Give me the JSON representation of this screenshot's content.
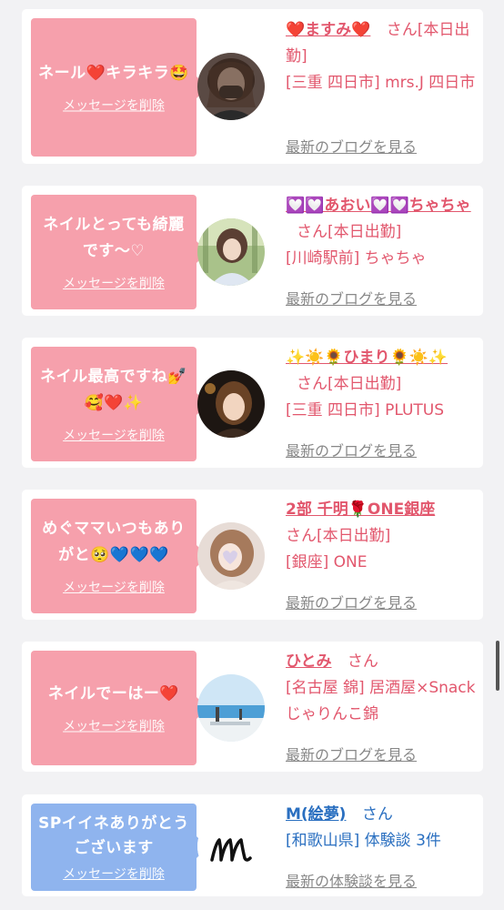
{
  "items": [
    {
      "message": "ネール❤️キラキラ🤩",
      "delete_label": "メッセージを削除",
      "name": "❤️ますみ❤️",
      "suffix": "さん[本日出勤]",
      "shop": "[三重 四日市] mrs.J 四日市",
      "more": "最新のブログを見る",
      "avatar": "woman-masked-avatar"
    },
    {
      "message": "ネイルとっても綺麗です〜♡",
      "delete_label": "メッセージを削除",
      "name": "💟💟あおい💟💟ちゃちゃ",
      "suffix": "さん[本日出勤]",
      "shop": "[川崎駅前] ちゃちゃ",
      "more": "最新のブログを見る",
      "avatar": "woman-outdoor-avatar"
    },
    {
      "message": "ネイル最高ですね💅🥰❤️✨",
      "delete_label": "メッセージを削除",
      "name": "✨☀️🌻ひまり🌻☀️✨",
      "suffix": "さん[本日出勤]",
      "shop": "[三重 四日市] PLUTUS",
      "more": "最新のブログを見る",
      "avatar": "woman-dark-avatar"
    },
    {
      "message": "めぐママいつもありがと🥺💙💙💙",
      "delete_label": "メッセージを削除",
      "name": "2部 千明🌹ONE銀座",
      "suffix": "さん[本日出勤]",
      "shop": "[銀座] ONE",
      "more": "最新のブログを見る",
      "avatar": "woman-heart-avatar"
    },
    {
      "message": "ネイルでーはー❤️",
      "delete_label": "メッセージを削除",
      "name": "ひとみ",
      "suffix": "さん",
      "shop": "[名古屋 錦] 居酒屋×Snack じゃりんこ錦",
      "more": "最新のブログを見る",
      "avatar": "beach-avatar"
    },
    {
      "message": "SPイイネありがとうございます",
      "delete_label": "メッセージを削除",
      "name": "M(絵夢)",
      "suffix": "さん",
      "shop": "[和歌山県] 体験談 3件",
      "more": "最新の体験談を見る",
      "avatar": "m-logo-avatar"
    }
  ],
  "colors": {
    "pink_bubble": "#f6a0ac",
    "blue_bubble": "#8fb4ee",
    "pink_text": "#e2576d",
    "blue_text": "#2a6fc0"
  }
}
